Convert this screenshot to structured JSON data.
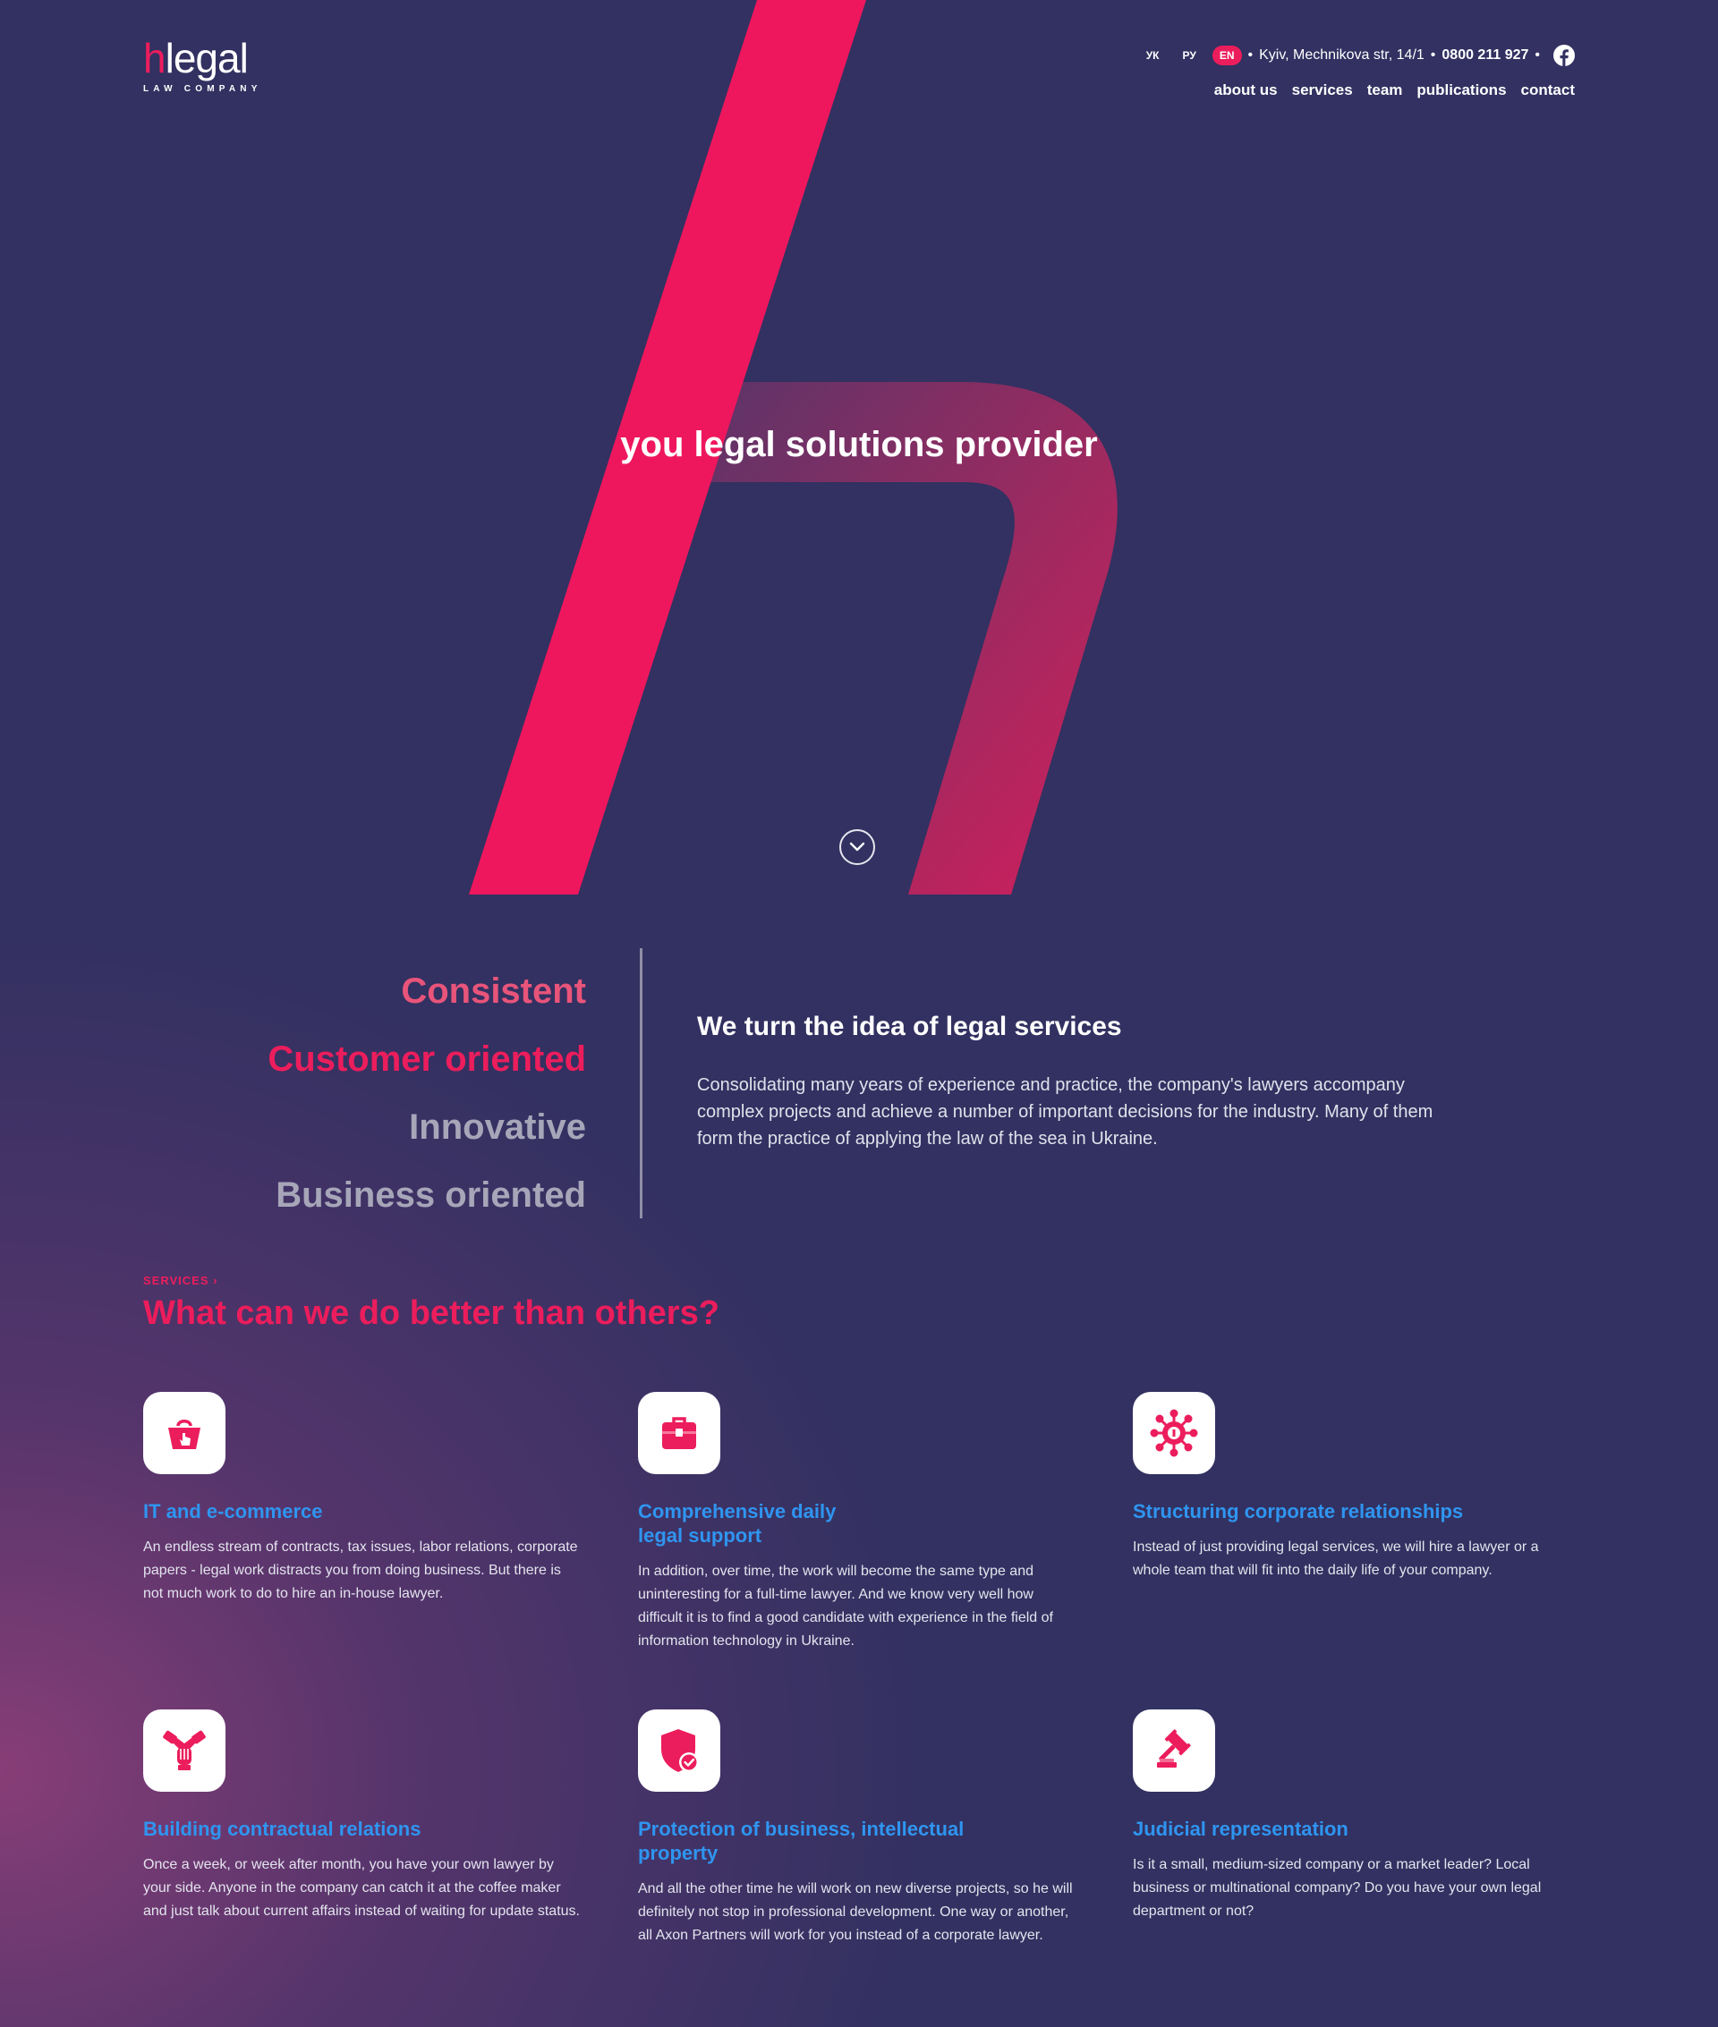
{
  "header": {
    "logo_h": "h",
    "logo_rest": "legal",
    "logo_sub": "LAW COMPANY",
    "languages": [
      {
        "label": "УК",
        "active": false
      },
      {
        "label": "РУ",
        "active": false
      },
      {
        "label": "EN",
        "active": true
      }
    ],
    "address": "Kyiv, Mechnikova str, 14/1",
    "phone": "0800 211 927",
    "social_icon": "facebook-icon",
    "nav": [
      "about us",
      "services",
      "team",
      "publications",
      "contact"
    ]
  },
  "hero": {
    "title": "you legal solutions provider",
    "scroll_icon": "chevron-down-icon"
  },
  "values": [
    "Consistent",
    "Customer oriented",
    "Innovative",
    "Business oriented"
  ],
  "about": {
    "title": "We turn the idea of legal services",
    "text": "Consolidating many years of experience and practice, the company's lawyers accompany complex projects and achieve a number of important decisions for the industry. Many of them form the practice of applying the law of the sea in Ukraine."
  },
  "services": {
    "kicker": "SERVICES",
    "title": "What can we do better than others?",
    "items": [
      {
        "icon": "shopping-basket-icon",
        "title": "IT and e-commerce",
        "text": "An endless stream of contracts, tax issues, labor relations, corporate papers - legal work distracts you from doing business. But there is not much work to do to hire an in-house lawyer."
      },
      {
        "icon": "briefcase-icon",
        "title": "Comprehensive daily legal support",
        "text": "In addition, over time, the work will become the same type and uninteresting for a full-time lawyer. And we know very well how difficult it is to find a good candidate with experience in the field of information technology in Ukraine."
      },
      {
        "icon": "network-icon",
        "title": "Structuring corporate relationships",
        "text": "Instead of just providing legal services, we will hire a lawyer or a whole team that will fit into the daily life of your company."
      },
      {
        "icon": "handshake-icon",
        "title": "Building contractual relations",
        "text": "Once a week, or week after month, you have your own lawyer by your side. Anyone in the company can catch it at the coffee maker and just talk about current affairs instead of waiting for update status."
      },
      {
        "icon": "shield-check-icon",
        "title": "Protection of business, intellectual property",
        "text": "And all the other time he will work on new diverse projects, so he will definitely not stop in professional development. One way or another, all Axon Partners will work for you instead of a corporate lawyer."
      },
      {
        "icon": "gavel-icon",
        "title": "Judicial representation",
        "text": "Is it a small, medium-sized company or a market leader? Local business or multinational company? Do you have your own legal department or not?"
      }
    ]
  },
  "colors": {
    "background": "#323161",
    "accent": "#ec1d5c",
    "link_blue": "#2f95f0",
    "glow": "#8c3e78"
  }
}
